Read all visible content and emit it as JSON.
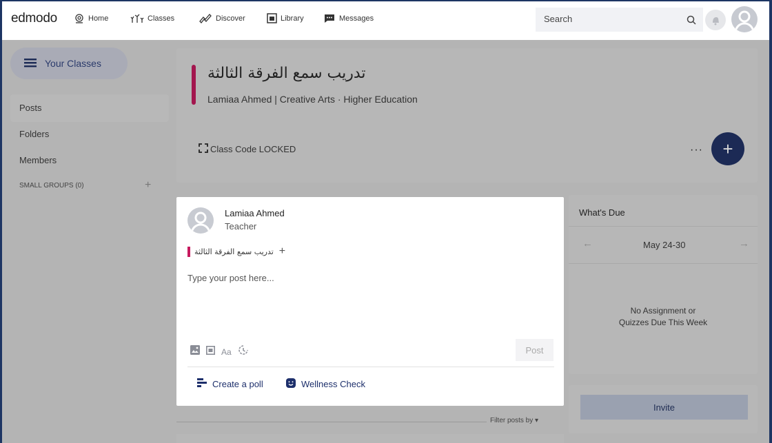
{
  "nav": {
    "logo": "edmodo",
    "items": [
      {
        "label": "Home",
        "icon": "home-icon"
      },
      {
        "label": "Classes",
        "icon": "classes-icon"
      },
      {
        "label": "Discover",
        "icon": "discover-icon"
      },
      {
        "label": "Library",
        "icon": "library-icon"
      },
      {
        "label": "Messages",
        "icon": "messages-icon"
      }
    ],
    "search_placeholder": "Search"
  },
  "sidebar": {
    "your_classes": "Your Classes",
    "links": [
      "Posts",
      "Folders",
      "Members"
    ],
    "small_groups": "SMALL GROUPS (0)",
    "active": "Posts"
  },
  "class_header": {
    "title": "تدريب سمع الفرقة الثالثة",
    "subtitle": "Lamiaa Ahmed | Creative Arts  · Higher Education",
    "class_code": "Class Code LOCKED",
    "accent_color": "#a3164e"
  },
  "composer": {
    "author": "Lamiaa Ahmed",
    "role": "Teacher",
    "target_class": "تدريب سمع الفرقة الثالثة",
    "placeholder": "Type your post here...",
    "post_label": "Post",
    "actions": [
      {
        "label": "Create a poll",
        "icon": "poll-icon"
      },
      {
        "label": "Wellness Check",
        "icon": "wellness-icon"
      }
    ],
    "tool_icons": [
      "image-icon",
      "library-icon",
      "text-format-icon",
      "schedule-icon"
    ],
    "accent_color": "#c71a5e"
  },
  "whats_due": {
    "title": "What's Due",
    "range": "May 24-30",
    "empty_line1": "No Assignment or",
    "empty_line2": "Quizzes Due This Week"
  },
  "invite": {
    "label": "Invite"
  },
  "feed": {
    "filter_label": "Filter posts by ▾"
  },
  "colors": {
    "brand_navy": "#1c2a55",
    "frame": "#1d3563"
  }
}
